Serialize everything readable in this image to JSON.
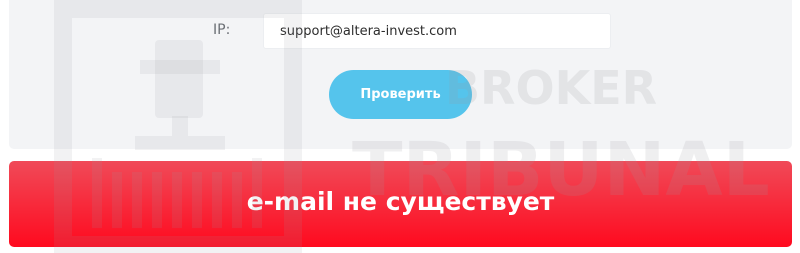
{
  "form": {
    "ip_label": "IP:",
    "ip_value": "support@altera-invest.com",
    "check_button": "Проверить"
  },
  "result": {
    "message": "e-mail не существует"
  },
  "watermark": {
    "line1": "BROKER",
    "line2": "TRIBUNAL"
  },
  "colors": {
    "panel_bg": "#f3f4f6",
    "button_accent": "#55c4ec",
    "error_red": "#ff0a1f"
  }
}
